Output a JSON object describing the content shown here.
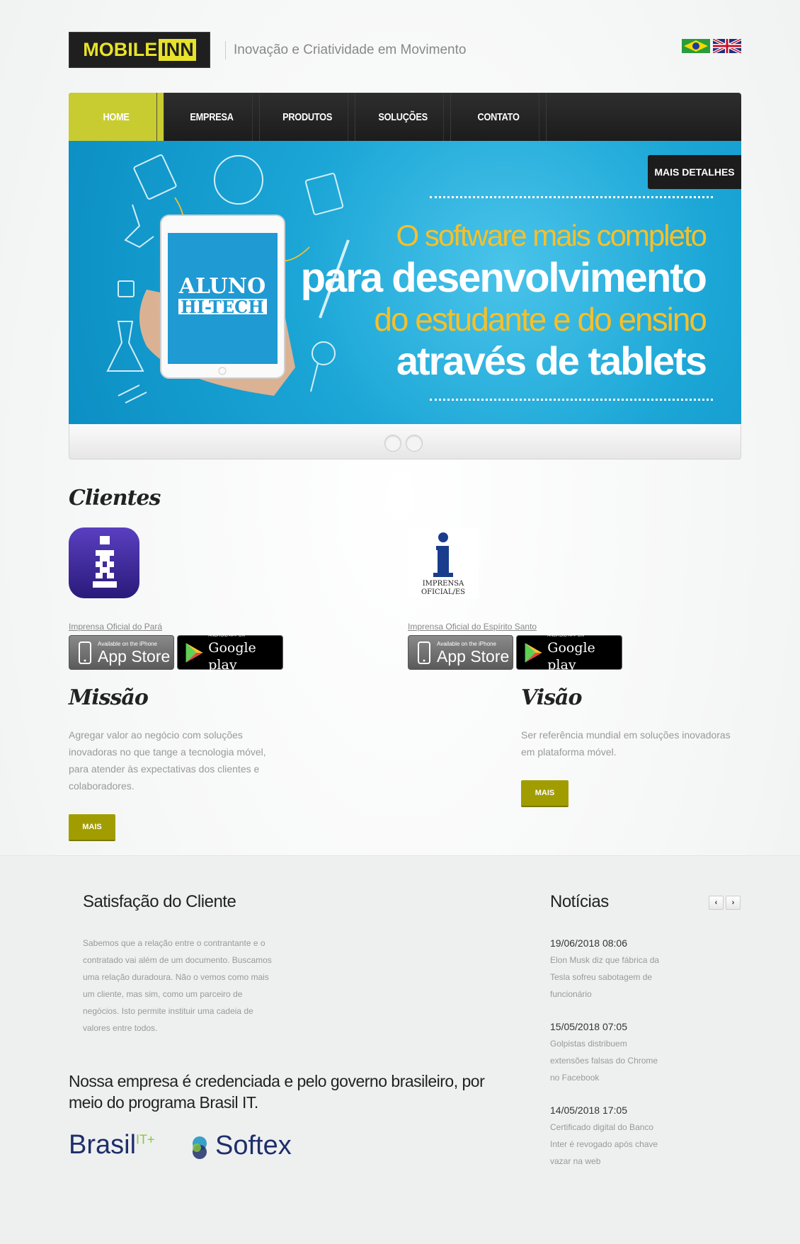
{
  "header": {
    "logo_part1": "MOBILE",
    "logo_part2": "INN",
    "tagline": "Inovação e Criatividade em Movimento",
    "flags": [
      "flag-brazil-icon",
      "flag-uk-icon"
    ]
  },
  "nav": {
    "items": [
      "HOME",
      "EMPRESA",
      "PRODUTOS",
      "SOLUÇÕES",
      "CONTATO"
    ],
    "active_color": "#c8cc30"
  },
  "banner": {
    "button": "MAIS DETALHES",
    "line1": "O software mais completo",
    "line2": "para desenvolvimento",
    "line3": "do estudante e do ensino",
    "line4": "através de tablets",
    "app_title1": "ALUNO",
    "app_title2": "HI-TECH"
  },
  "clientes": {
    "title": "Clientes",
    "items": [
      {
        "name": "Imprensa Oficial do Pará",
        "logo": "info-i-icon"
      },
      {
        "name": "Imprensa Oficial do Espírito Santo",
        "logo": "imprensa-oficial-es-logo",
        "logo_text1": "IMPRENSA",
        "logo_text2": "OFICIAL/ES"
      }
    ],
    "appstore_small": "Available on the iPhone",
    "appstore_big": "App Store",
    "googleplay_small": "ANDROID APP ON",
    "googleplay_big": "Google play"
  },
  "missao": {
    "title": "Missão",
    "text": "Agregar valor ao negócio com soluções inovadoras no que tange a tecnologia móvel, para atender às expectativas dos clientes e colaboradores.",
    "button": "MAIS"
  },
  "visao": {
    "title": "Visão",
    "text": "Ser referência mundial em soluções inovadoras em plataforma móvel.",
    "button": "MAIS"
  },
  "footer": {
    "satisfacao_title": "Satisfação do Cliente",
    "satisfacao_text": "Sabemos que a relação entre o contrantante e o contratado vai além de um documento. Buscamos uma relação duradoura. Não o vemos como mais um cliente, mas sim, como um parceiro de negócios. Isto permite instituir uma cadeia de valores entre todos.",
    "noticias_title": "Notícias",
    "news": [
      {
        "date": "19/06/2018 08:06",
        "text": "Elon Musk diz que fábrica da Tesla sofreu sabotagem de funcionário"
      },
      {
        "date": "15/05/2018 07:05",
        "text": "Golpistas distribuem extensões falsas do Chrome no Facebook"
      },
      {
        "date": "14/05/2018 17:05",
        "text": "Certificado digital do Banco Inter é revogado após chave vazar na web"
      }
    ],
    "credenciada": "Nossa empresa é credenciada e pelo governo brasileiro, por meio do programa Brasil IT.",
    "brasil_logo": "Brasil",
    "brasil_sup": "IT+",
    "softex_logo": "Softex"
  },
  "colors": {
    "olive": "#a19d00",
    "banner_blue": "#1ba6d6",
    "banner_yellow": "#f6c02a"
  }
}
